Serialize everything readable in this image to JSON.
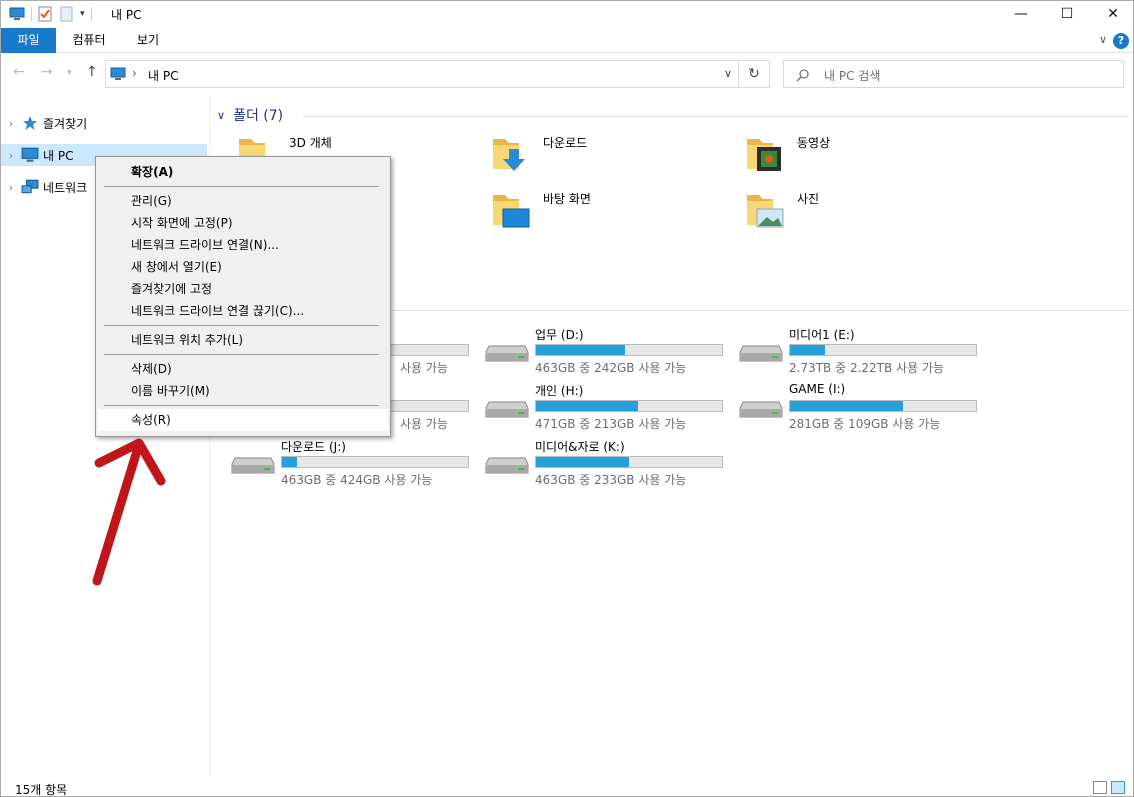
{
  "window": {
    "title": "내 PC",
    "controls": {
      "minimize": "—",
      "maximize": "☐",
      "close": "✕"
    }
  },
  "ribbon": {
    "tabs": [
      {
        "label": "파일"
      },
      {
        "label": "컴퓨터"
      },
      {
        "label": "보기"
      }
    ],
    "help": "?"
  },
  "address": {
    "path": "내 PC",
    "search_placeholder": "내 PC 검색"
  },
  "sidebar": {
    "items": [
      {
        "label": "즐겨찾기",
        "icon": "star-icon"
      },
      {
        "label": "내 PC",
        "icon": "computer-icon",
        "selected": true
      },
      {
        "label": "네트워크",
        "icon": "network-icon"
      }
    ]
  },
  "folders": {
    "header": "폴더 (7)",
    "items": [
      {
        "name": "3D 개체",
        "icon": "3d-objects-folder-icon"
      },
      {
        "name": "다운로드",
        "icon": "downloads-folder-icon"
      },
      {
        "name": "동영상",
        "icon": "videos-folder-icon"
      },
      {
        "name": "바탕 화면",
        "icon": "desktop-folder-icon"
      },
      {
        "name": "사진",
        "icon": "pictures-folder-icon"
      }
    ]
  },
  "drives": {
    "items": [
      {
        "name": "업무 (D:)",
        "free": "463GB 중 242GB 사용 가능",
        "used_fraction": 0.48
      },
      {
        "name": "미디어1 (E:)",
        "free": "2.73TB 중 2.22TB 사용 가능",
        "used_fraction": 0.19
      },
      {
        "name": "개인 (H:)",
        "free": "471GB 중 213GB 사용 가능",
        "used_fraction": 0.55
      },
      {
        "name": "GAME (I:)",
        "free": "281GB 중 109GB 사용 가능",
        "used_fraction": 0.61
      },
      {
        "name": "다운로드 (J:)",
        "free": "463GB 중 424GB 사용 가능",
        "used_fraction": 0.08
      },
      {
        "name": "미디어&자로 (K:)",
        "free": "463GB 중 233GB 사용 가능",
        "used_fraction": 0.5
      }
    ],
    "partial_free_1": "사용 가능",
    "partial_free_2": "사용 가능"
  },
  "context_menu": {
    "items": [
      {
        "label": "확장(A)"
      },
      {
        "label": "관리(G)"
      },
      {
        "label": "시작 화면에 고정(P)"
      },
      {
        "label": "네트워크 드라이브 연결(N)..."
      },
      {
        "label": "새 창에서 열기(E)"
      },
      {
        "label": "즐겨찾기에 고정"
      },
      {
        "label": "네트워크 드라이브 연결 끊기(C)..."
      },
      {
        "label": "네트워크 위치 추가(L)"
      },
      {
        "label": "삭제(D)"
      },
      {
        "label": "이름 바꾸기(M)"
      },
      {
        "label": "속성(R)"
      }
    ]
  },
  "status": {
    "count": "15개 항목"
  },
  "colors": {
    "accent": "#1979ca",
    "selection": "#cce8ff",
    "drive_bar": "#26a0da",
    "annotation_arrow": "#c0161b"
  }
}
